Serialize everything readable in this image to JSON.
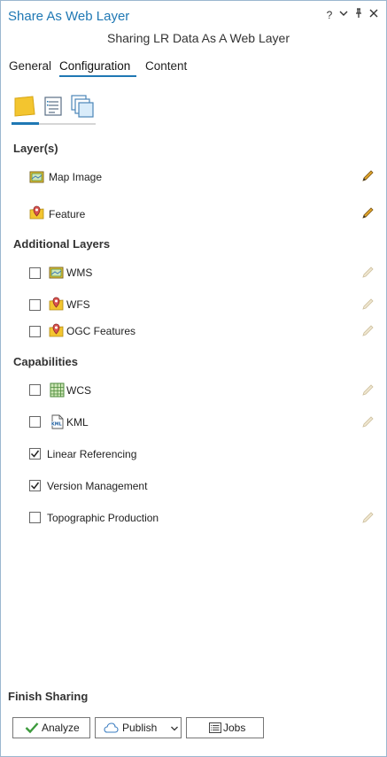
{
  "window": {
    "title": "Share As Web Layer",
    "help_glyph": "?",
    "menu_glyph": "⌄",
    "pin_glyph": "⊥",
    "close_glyph": "✕"
  },
  "subtitle": "Sharing LR Data As A Web Layer",
  "tabs": [
    {
      "label": "General",
      "active": false
    },
    {
      "label": "Configuration",
      "active": true
    },
    {
      "label": "Content",
      "active": false
    }
  ],
  "icon_tabs": [
    {
      "name": "layers-icon",
      "active": true
    },
    {
      "name": "properties-icon",
      "active": false
    },
    {
      "name": "pages-icon",
      "active": false
    }
  ],
  "layers_section": {
    "heading": "Layer(s)",
    "items": [
      {
        "label": "Map Image",
        "icon": "map-image-icon"
      },
      {
        "label": "Feature",
        "icon": "feature-layer-icon"
      }
    ]
  },
  "additional_section": {
    "heading": "Additional Layers",
    "items": [
      {
        "label": "WMS",
        "checked": false,
        "icon": "wms-icon"
      },
      {
        "label": "WFS",
        "checked": false,
        "icon": "wfs-icon"
      },
      {
        "label": "OGC Features",
        "checked": false,
        "icon": "ogc-features-icon"
      }
    ]
  },
  "capabilities_section": {
    "heading": "Capabilities",
    "items": [
      {
        "label": "WCS",
        "checked": false,
        "icon": "wcs-grid-icon"
      },
      {
        "label": "KML",
        "checked": false,
        "icon": "kml-file-icon"
      },
      {
        "label": "Linear Referencing",
        "checked": true
      },
      {
        "label": "Version Management",
        "checked": true
      },
      {
        "label": "Topographic Production",
        "checked": false
      }
    ]
  },
  "finish": {
    "heading": "Finish Sharing",
    "analyze_label": "Analyze",
    "publish_label": "Publish",
    "jobs_label": "Jobs"
  },
  "colors": {
    "accent": "#1f78b4",
    "folder_yellow": "#f3c52f",
    "pencil_active": "#c48a1c",
    "pencil_disabled": "#d9d2c4"
  }
}
